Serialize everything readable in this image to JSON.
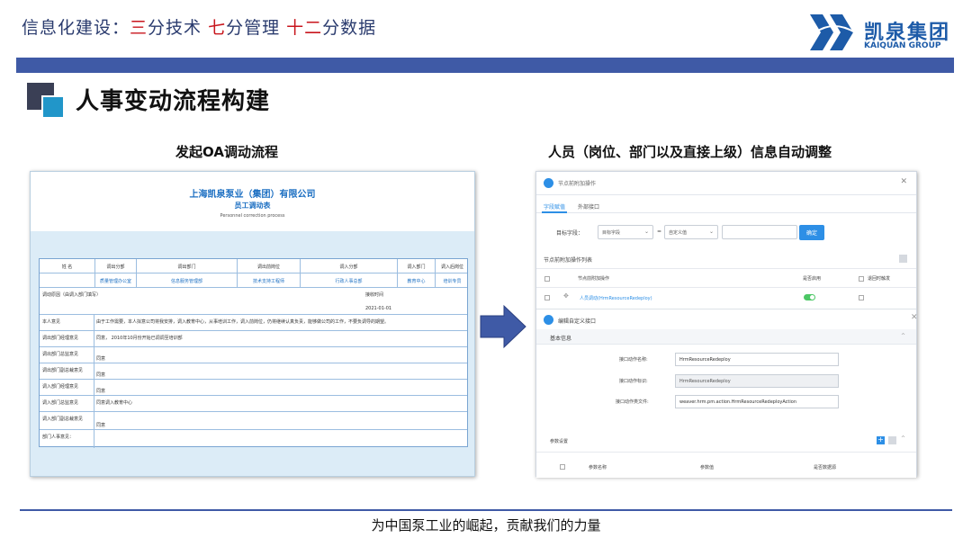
{
  "header": {
    "prefix": "信息化建设：",
    "part1_red": "三",
    "part1_rest": "分技术  ",
    "part2_red": "七",
    "part2_rest": "分管理  ",
    "part3_red": "十二",
    "part3_rest": "分数据",
    "logo_cn": "凯泉集团",
    "logo_en": "KAIQUAN GROUP"
  },
  "title": "人事变动流程构建",
  "left_caption": "发起OA调动流程",
  "right_caption": "人员（岗位、部门以及直接上级）信息自动调整",
  "form": {
    "company": "上海凯泉泵业（集团）有限公司",
    "name": "员工调动表",
    "subtitle": "Personnel correction process",
    "headers": [
      "姓  名",
      "调出分部",
      "调出部门",
      "调出前岗位",
      "调入分部",
      "调入部门",
      "调入后岗位"
    ],
    "values": [
      "",
      "质量管理办公室",
      "信息服务管理部",
      "技术支持工程师",
      "行政人事总部",
      "教育中心",
      "培训专员"
    ],
    "reason_label": "调动原因（由调入部门填写）",
    "reason_time_label": "接收时间",
    "reason_date": "2021-01-01",
    "rows": [
      {
        "label": "本人意见",
        "text": "由于工作需要，本人拟意公司将我安排，调入教育中心，从事培训工作，调入前岗位，仍将继续认真负责，能够做公司的工作，不要负调导的期望。"
      },
      {
        "label": "调出部门经理意见",
        "text": "同意，    2010年10月份开始已调调至培训部"
      },
      {
        "label": "调出部门总监意见",
        "text": "同意"
      },
      {
        "label": "调出部门副总裁意见",
        "text": "同意"
      },
      {
        "label": "调入部门经理意见",
        "text": "同意"
      },
      {
        "label": "调入部门总监意见",
        "text": "同意调入教育中心"
      },
      {
        "label": "调入部门副总裁意见",
        "text": "同意"
      },
      {
        "label": "部门人事意见：",
        "text": ""
      }
    ]
  },
  "oa": {
    "dialog_title": "节点前附加操作",
    "tab_active": "字段赋值",
    "tab_other": "外部接口",
    "target_label": "目标字段：",
    "target_value": "目标字段",
    "equals": "=",
    "custom_value": "自定义值",
    "confirm_btn": "确定",
    "list_title": "节点前附加操作列表",
    "col_action": "节点前附加操作",
    "col_enabled": "是否启用",
    "col_return": "退回时触发",
    "row_link": "人员调动(HrmResourceRedeploy)",
    "modal_title": "编辑自定义接口",
    "basic_info": "基本信息",
    "field1_label": "接口动作名称:",
    "field1_value": "HrmResourceRedeploy",
    "field2_label": "接口动作标识:",
    "field2_value": "HrmResourceRedeploy",
    "field3_label": "接口动作类文件:",
    "field3_value": "weaver.hrm.pm.action.HrmResourceRedeployAction",
    "param_section": "参数设置",
    "param_col1": "参数名称",
    "param_col2": "参数值",
    "param_col3": "是否数据源"
  },
  "footer": "为中国泵工业的崛起，贡献我们的力量",
  "colors": {
    "accent_blue": "#3f5aa6",
    "red": "#c8161d",
    "link_blue": "#2d8fe6"
  }
}
